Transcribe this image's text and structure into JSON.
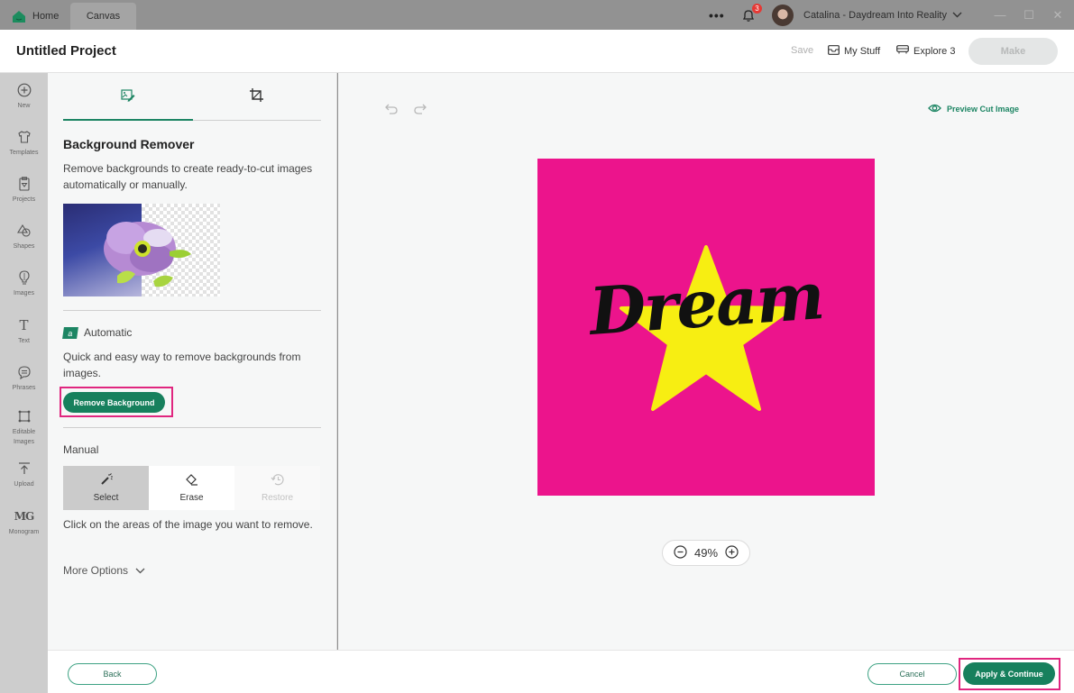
{
  "titlebar": {
    "tabs": [
      {
        "label": "Home",
        "icon": "home-icon"
      },
      {
        "label": "Canvas",
        "active": true
      }
    ],
    "more_icon": "more-dots-icon",
    "notifications": {
      "icon": "bell-icon",
      "count": "3"
    },
    "user": {
      "name": "Catalina - Daydream Into Reality",
      "icon": "chevron-down-icon"
    },
    "window_controls": [
      "minimize",
      "maximize",
      "close"
    ],
    "window_glyphs": {
      "minimize": "—",
      "maximize": "☐",
      "close": "✕"
    }
  },
  "header": {
    "project_title": "Untitled Project",
    "save_label": "Save",
    "my_stuff_label": "My Stuff",
    "explore_label": "Explore 3",
    "make_label": "Make"
  },
  "rail": {
    "items": [
      {
        "label": "New",
        "icon": "plus-circle-icon"
      },
      {
        "label": "Templates",
        "icon": "shirt-icon"
      },
      {
        "label": "Projects",
        "icon": "clipboard-icon"
      },
      {
        "label": "Shapes",
        "icon": "shapes-icon"
      },
      {
        "label": "Images",
        "icon": "lightbulb-icon"
      },
      {
        "label": "Text",
        "icon": "text-icon"
      },
      {
        "label": "Phrases",
        "icon": "speech-bubble-icon"
      },
      {
        "label": "Editable Images",
        "icon": "editable-image-icon"
      },
      {
        "label": "Upload",
        "icon": "upload-icon"
      },
      {
        "label": "Monogram",
        "icon": "monogram-icon"
      }
    ]
  },
  "panel": {
    "tabs": [
      {
        "name": "background-remover",
        "icon": "image-edit-icon",
        "active": true
      },
      {
        "name": "crop",
        "icon": "crop-icon",
        "active": false
      }
    ],
    "title": "Background Remover",
    "description": "Remove backgrounds to create ready-to-cut images automatically or manually.",
    "automatic": {
      "label": "Automatic",
      "icon_letter": "a",
      "description": "Quick and easy way to remove backgrounds from images.",
      "button_label": "Remove Background"
    },
    "manual": {
      "label": "Manual",
      "tools": [
        {
          "label": "Select",
          "icon": "magic-wand-icon",
          "state": "selected"
        },
        {
          "label": "Erase",
          "icon": "eraser-icon",
          "state": "enabled"
        },
        {
          "label": "Restore",
          "icon": "history-icon",
          "state": "disabled"
        }
      ],
      "description": "Click on the areas of the image you want to remove."
    },
    "more_options_label": "More Options"
  },
  "canvas": {
    "preview_label": "Preview Cut Image",
    "artwork_text": "Dream",
    "zoom_value": "49%",
    "colors": {
      "background": "#ec148c",
      "star": "#f7ee12",
      "text": "#111111"
    }
  },
  "footer": {
    "back_label": "Back",
    "cancel_label": "Cancel",
    "apply_label": "Apply & Continue"
  },
  "colors": {
    "accent": "#17805d",
    "highlight": "#e0267f"
  }
}
